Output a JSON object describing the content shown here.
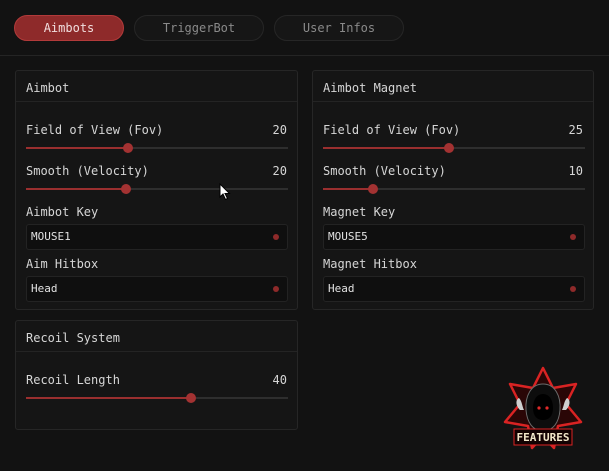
{
  "tabs": [
    {
      "label": "Aimbots",
      "active": true
    },
    {
      "label": "TriggerBot",
      "active": false
    },
    {
      "label": "User Infos",
      "active": false
    }
  ],
  "aimbot": {
    "title": "Aimbot",
    "fov": {
      "label": "Field of View (Fov)",
      "value": "20",
      "level": 0.39
    },
    "smooth": {
      "label": "Smooth (Velocity)",
      "value": "20",
      "level": 0.38
    },
    "key": {
      "label": "Aimbot Key",
      "value": "MOUSE1"
    },
    "hitbox": {
      "label": "Aim Hitbox",
      "value": "Head"
    }
  },
  "magnet": {
    "title": "Aimbot Magnet",
    "fov": {
      "label": "Field of View (Fov)",
      "value": "25",
      "level": 0.48
    },
    "smooth": {
      "label": "Smooth (Velocity)",
      "value": "10",
      "level": 0.19
    },
    "key": {
      "label": "Magnet Key",
      "value": "MOUSE5"
    },
    "hitbox": {
      "label": "Magnet Hitbox",
      "value": "Head"
    }
  },
  "recoil": {
    "title": "Recoil System",
    "length": {
      "label": "Recoil Length",
      "value": "40",
      "level": 0.63
    }
  },
  "colors": {
    "accent": "#9a2f2f",
    "background": "#121212",
    "panel": "#151515"
  },
  "logo": {
    "text": "FEATURES",
    "icon": "hooded-figure-logo"
  }
}
